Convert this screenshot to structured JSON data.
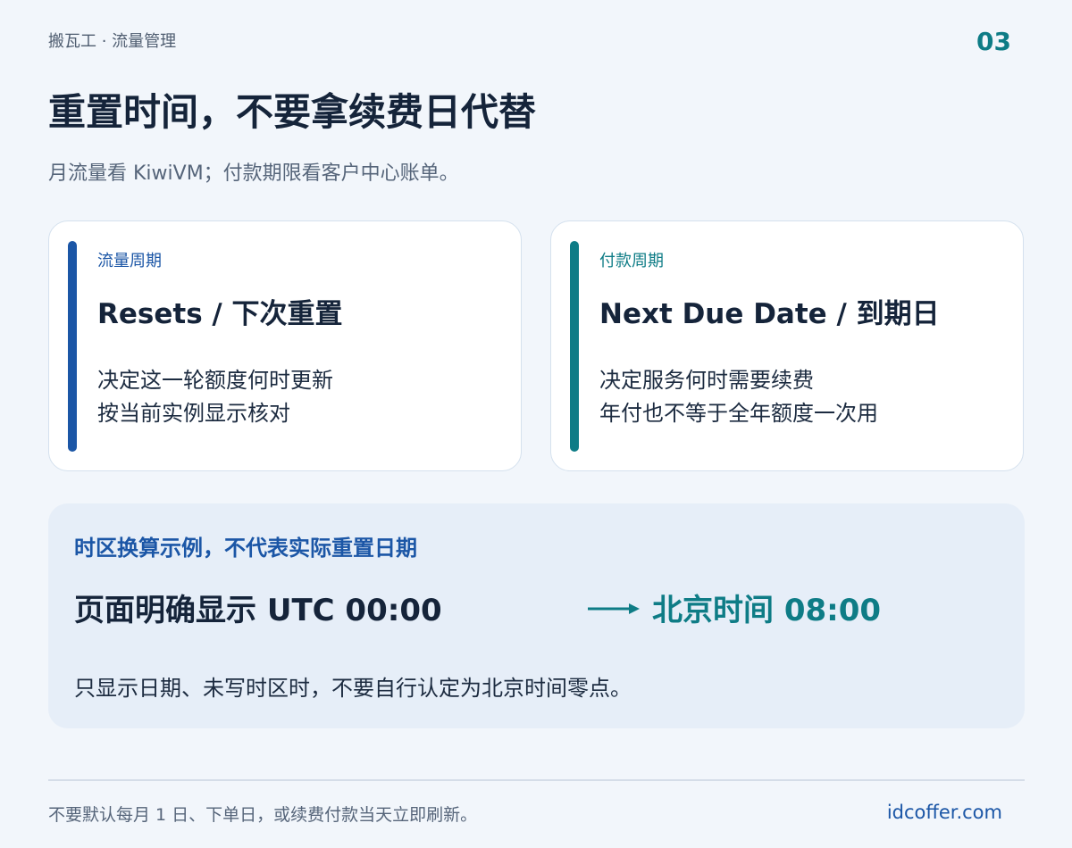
{
  "header": {
    "breadcrumb": "搬瓦工 · 流量管理",
    "page_number": "03",
    "title": "重置时间，不要拿续费日代替",
    "subtitle": "月流量看 KiwiVM；付款期限看客户中心账单。"
  },
  "cards": [
    {
      "label": "流量周期",
      "heading": "Resets / 下次重置",
      "lines": [
        "决定这一轮额度何时更新",
        "按当前实例显示核对"
      ]
    },
    {
      "label": "付款周期",
      "heading": "Next Due Date / 到期日",
      "lines": [
        "决定服务何时需要续费",
        "年付也不等于全年额度一次用"
      ]
    }
  ],
  "panel": {
    "title": "时区换算示例，不代表实际重置日期",
    "from": "页面明确显示 UTC 00:00",
    "to": "北京时间 08:00",
    "note": "只显示日期、未写时区时，不要自行认定为北京时间零点。"
  },
  "footer": {
    "note": "不要默认每月 1 日、下单日，或续费付款当天立即刷新。",
    "brand": "idcoffer.com"
  },
  "colors": {
    "background": "#f2f6fb",
    "primary_blue": "#1b56a6",
    "accent_teal": "#0e7c86",
    "text_dark": "#15243a"
  },
  "icons": {
    "arrow": "arrow-right-icon"
  }
}
